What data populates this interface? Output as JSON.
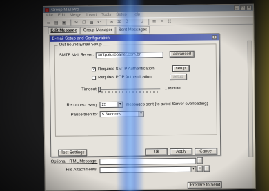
{
  "app": {
    "title": "Group Mail Pro"
  },
  "menu": [
    "File",
    "Edit",
    "Merge",
    "Insert",
    "Tools",
    "Setup",
    "Help"
  ],
  "tabs": [
    "Edit Message",
    "Group Manager",
    "Sent Messages"
  ],
  "dialog": {
    "title": "E-mail Setup and Configuration",
    "group_label": "Out bound Email Setup",
    "smtp_label": "SMTP Mail Server:",
    "smtp_value": "smtp.europanet.com.br",
    "advanced_label": "advanced",
    "req_smtp_auth_label": "Requires SMTP Authentication",
    "req_smtp_auth_checked": true,
    "req_pop_auth_label": "Requires POP Authentication",
    "req_pop_auth_checked": false,
    "setup_label_1": "setup",
    "setup_label_2": "setup",
    "timeout_label": "Timeout",
    "timeout_value_text": "1 Minute",
    "reconnect_label": "Reconnect every",
    "reconnect_value": "25",
    "reconnect_suffix": "messages sent (to avoid Server overloading)",
    "pause_label": "Pause then for",
    "pause_value": "5 Seconds",
    "test_settings_label": "Test Settings",
    "ok_label": "Ok",
    "apply_label": "Apply",
    "cancel_label": "Cancel"
  },
  "bottom": {
    "optional_html_label": "Optional HTML Message:",
    "file_attachments_label": "File Attachments:",
    "prepare_to_send_label": "Prepare to Send"
  },
  "window_buttons": [
    "_",
    "□",
    "x"
  ]
}
